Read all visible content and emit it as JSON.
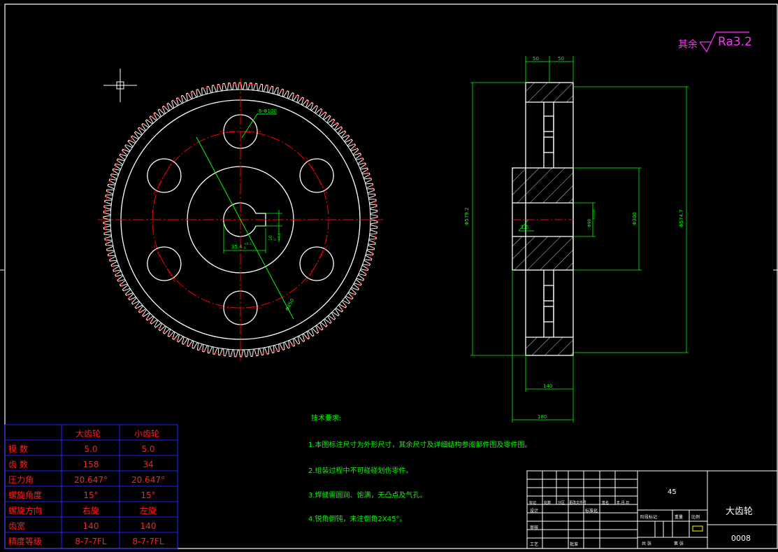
{
  "roughness": {
    "prefix": "其余",
    "value": "Ra3.2"
  },
  "front_view": {
    "hole_label": "6-Φ100",
    "ref_label": "Φ450"
  },
  "keyway": {
    "width": "35.4",
    "tol_top": "+0.2",
    "tol_bottom": "0",
    "depth": "10",
    "depth_tol": "0",
    "depth_tol2": "+0.1"
  },
  "side_view": {
    "dim_top_left": "50",
    "dim_top_right": "50",
    "dim_outer": "Φ579.2",
    "dim_root": "Φ574.7",
    "dim_hub": "Φ300",
    "dim_bore": "Φ90",
    "bore_tol": "+0.035",
    "chamfer": "1.6",
    "dim_face": "140",
    "dim_hub_len": "180"
  },
  "tech_requirements": {
    "title": "技术要求:",
    "items": [
      "1.本图标注尺寸为外形尺寸，其余尺寸及详细结构参阅部件图及零件图。",
      "2.组装过程中不可碰碰划伤零件。",
      "3.焊缝需圆润、饱满，无凸点及气孔。",
      "4.锐角倒钝，未注倒角2X45°。"
    ]
  },
  "param_table": {
    "headers": [
      "",
      "大齿轮",
      "小齿轮"
    ],
    "rows": [
      [
        "模  数",
        "5.0",
        "5.0"
      ],
      [
        "齿  数",
        "158",
        "34"
      ],
      [
        "压力角",
        "20.647°",
        "20.647°"
      ],
      [
        "螺旋角度",
        "15°",
        "15°"
      ],
      [
        "螺旋方向",
        "右旋",
        "左旋"
      ],
      [
        "齿宽",
        "140",
        "140"
      ],
      [
        "精度等级",
        "8-7-7FL",
        "8-7-7FL"
      ]
    ]
  },
  "title_block": {
    "material": "45",
    "part_name": "大齿轮",
    "drawing_no": "0008",
    "col_labels": [
      "标记",
      "处数",
      "分区",
      "更改文件号",
      "签名",
      "年.月.日"
    ],
    "design": "设计",
    "standard": "标准化",
    "review": "审核",
    "process": "工艺",
    "approve": "批准",
    "stage": "阶段标记",
    "weight": "重量",
    "scale": "比例",
    "sheets": "共  张",
    "sheet": "第  张"
  },
  "colors": {
    "background": "#000000",
    "outline": "#ffffff",
    "center": "#ff0000",
    "dim": "#00ff00",
    "table": "#2222ff",
    "table_text": "#ff2020",
    "magenta": "#ff33ff",
    "yellow": "#ffff00"
  }
}
